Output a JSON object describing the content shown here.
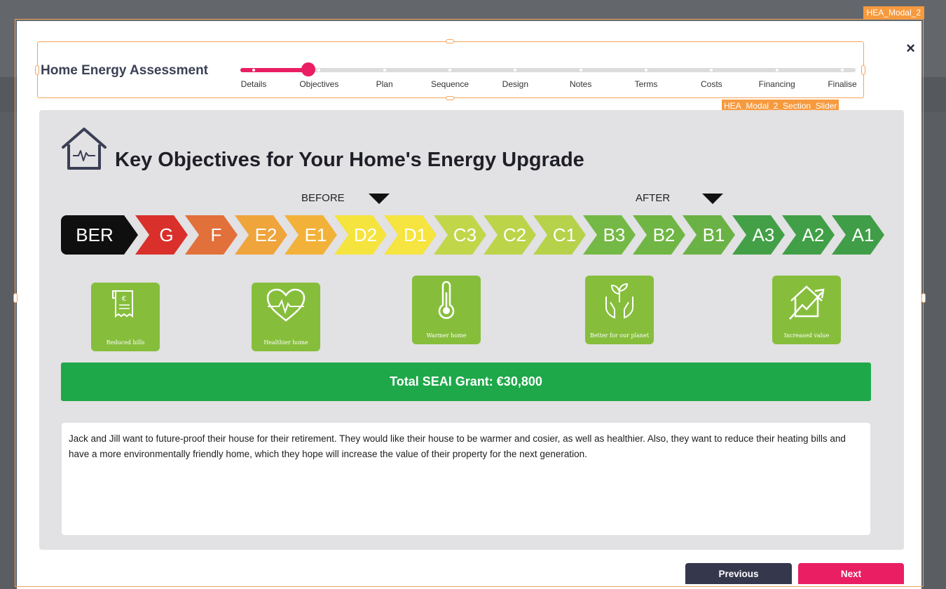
{
  "outline_tags": {
    "modal": "HEA_Modal_2",
    "slider": "HEA_Modal_2_Section_Slider"
  },
  "slider": {
    "title": "Home Energy Assessment",
    "progress": 0.11,
    "steps": [
      "Details",
      "Objectives",
      "Plan",
      "Sequence",
      "Design",
      "Notes",
      "Terms",
      "Costs",
      "Financing",
      "Finalise"
    ],
    "active_step": "Objectives",
    "accent_color": "#e91e63"
  },
  "close_icon": "×",
  "panel": {
    "title": "Key Objectives for Your Home's Energy Upgrade",
    "before_label": "BEFORE",
    "after_label": "AFTER",
    "ber_scale": [
      {
        "label": "BER",
        "color": "#0f0f0f"
      },
      {
        "label": "G",
        "color": "#d9302c"
      },
      {
        "label": "F",
        "color": "#e2703a"
      },
      {
        "label": "E2",
        "color": "#efa43c"
      },
      {
        "label": "E1",
        "color": "#f2b23a"
      },
      {
        "label": "D2",
        "color": "#f5e43e"
      },
      {
        "label": "D1",
        "color": "#f6e440"
      },
      {
        "label": "C3",
        "color": "#c2d64a"
      },
      {
        "label": "C2",
        "color": "#bcd44a"
      },
      {
        "label": "C1",
        "color": "#b6d24a"
      },
      {
        "label": "B3",
        "color": "#74b945"
      },
      {
        "label": "B2",
        "color": "#6fb645"
      },
      {
        "label": "B1",
        "color": "#6ab245"
      },
      {
        "label": "A3",
        "color": "#43a047"
      },
      {
        "label": "A2",
        "color": "#41a047"
      },
      {
        "label": "A1",
        "color": "#3f9e47"
      }
    ],
    "objectives": [
      {
        "label": "Reduced bills",
        "icon": "receipt-euro-icon"
      },
      {
        "label": "Healthier home",
        "icon": "heart-pulse-icon"
      },
      {
        "label": "Warmer home",
        "icon": "thermometer-icon"
      },
      {
        "label": "Better for our planet",
        "icon": "hands-plant-icon"
      },
      {
        "label": "Increased value",
        "icon": "house-growth-icon"
      }
    ],
    "grant_text": "Total SEAI Grant: €30,800",
    "grant_color": "#1ea84a",
    "notes": "Jack and Jill want to future-proof their house for their retirement. They would like their house to be warmer and cosier, as well as healthier. Also, they want to reduce their heating bills and have a more environmentally friendly home, which they hope will increase the value of their property for the next generation."
  },
  "buttons": {
    "previous": "Previous",
    "next": "Next"
  }
}
